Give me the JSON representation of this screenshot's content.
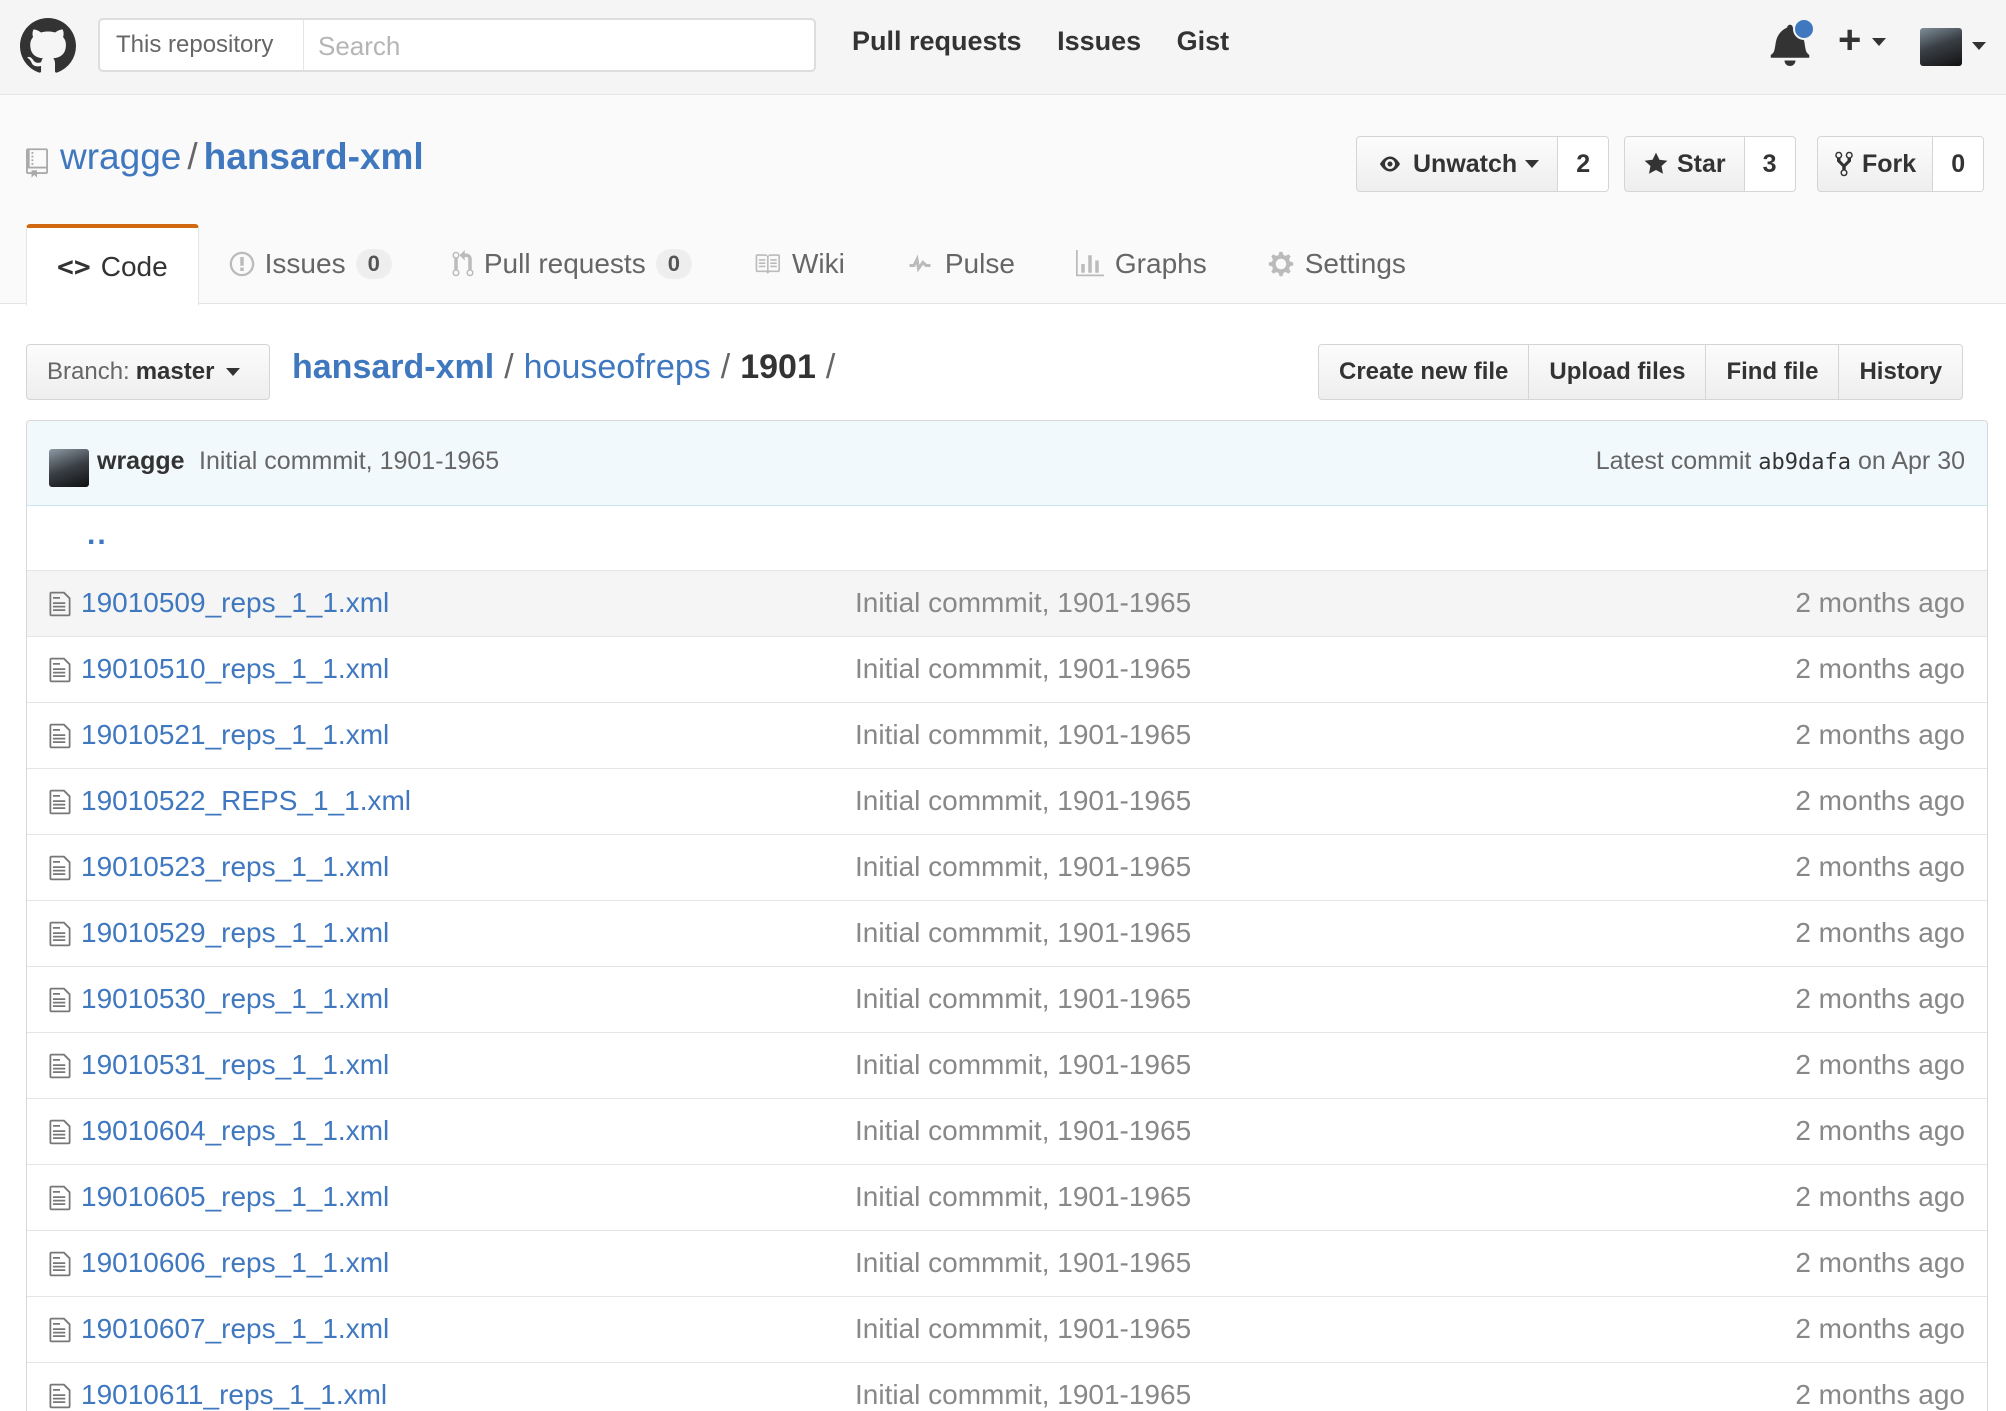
{
  "header": {
    "search_scope": "This repository",
    "search_placeholder": "Search",
    "nav": [
      "Pull requests",
      "Issues",
      "Gist"
    ]
  },
  "repo": {
    "owner": "wragge",
    "name": "hansard-xml",
    "unwatch_label": "Unwatch",
    "watch_count": "2",
    "star_label": "Star",
    "star_count": "3",
    "fork_label": "Fork",
    "fork_count": "0"
  },
  "tabs": [
    {
      "label": "Code"
    },
    {
      "label": "Issues",
      "count": "0"
    },
    {
      "label": "Pull requests",
      "count": "0"
    },
    {
      "label": "Wiki"
    },
    {
      "label": "Pulse"
    },
    {
      "label": "Graphs"
    },
    {
      "label": "Settings"
    }
  ],
  "branch": {
    "prefix": "Branch:",
    "name": "master"
  },
  "breadcrumb": {
    "root": "hansard-xml",
    "dir": "houseofreps",
    "current": "1901",
    "sep": "/"
  },
  "file_nav": [
    "Create new file",
    "Upload files",
    "Find file",
    "History"
  ],
  "latest_commit": {
    "author": "wragge",
    "message": "Initial commmit, 1901-1965",
    "prefix": "Latest commit",
    "sha": "ab9dafa",
    "date": "on Apr 30"
  },
  "up_link": "..",
  "files": [
    {
      "name": "19010509_reps_1_1.xml",
      "message": "Initial commmit, 1901-1965",
      "age": "2 months ago"
    },
    {
      "name": "19010510_reps_1_1.xml",
      "message": "Initial commmit, 1901-1965",
      "age": "2 months ago"
    },
    {
      "name": "19010521_reps_1_1.xml",
      "message": "Initial commmit, 1901-1965",
      "age": "2 months ago"
    },
    {
      "name": "19010522_REPS_1_1.xml",
      "message": "Initial commmit, 1901-1965",
      "age": "2 months ago"
    },
    {
      "name": "19010523_reps_1_1.xml",
      "message": "Initial commmit, 1901-1965",
      "age": "2 months ago"
    },
    {
      "name": "19010529_reps_1_1.xml",
      "message": "Initial commmit, 1901-1965",
      "age": "2 months ago"
    },
    {
      "name": "19010530_reps_1_1.xml",
      "message": "Initial commmit, 1901-1965",
      "age": "2 months ago"
    },
    {
      "name": "19010531_reps_1_1.xml",
      "message": "Initial commmit, 1901-1965",
      "age": "2 months ago"
    },
    {
      "name": "19010604_reps_1_1.xml",
      "message": "Initial commmit, 1901-1965",
      "age": "2 months ago"
    },
    {
      "name": "19010605_reps_1_1.xml",
      "message": "Initial commmit, 1901-1965",
      "age": "2 months ago"
    },
    {
      "name": "19010606_reps_1_1.xml",
      "message": "Initial commmit, 1901-1965",
      "age": "2 months ago"
    },
    {
      "name": "19010607_reps_1_1.xml",
      "message": "Initial commmit, 1901-1965",
      "age": "2 months ago"
    },
    {
      "name": "19010611_reps_1_1.xml",
      "message": "Initial commmit, 1901-1965",
      "age": "2 months ago"
    }
  ]
}
